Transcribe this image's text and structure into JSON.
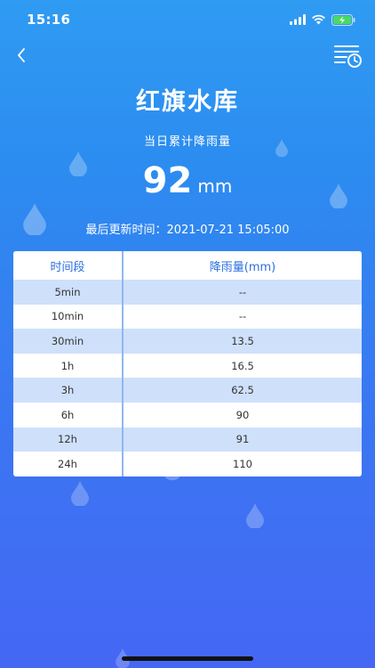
{
  "status": {
    "time": "15:16"
  },
  "page": {
    "title": "红旗水库",
    "subtitle": "当日累计降雨量",
    "value": "92",
    "unit": "mm",
    "update_label": "最后更新时间：",
    "update_time": "2021-07-21 15:05:00"
  },
  "icons": {
    "back": "back-chevron-icon",
    "history": "history-list-clock-icon"
  },
  "table": {
    "headers": [
      "时间段",
      "降雨量(mm)"
    ],
    "rows": [
      {
        "period": "5min",
        "rain": "--"
      },
      {
        "period": "10min",
        "rain": "--"
      },
      {
        "period": "30min",
        "rain": "13.5"
      },
      {
        "period": "1h",
        "rain": "16.5"
      },
      {
        "period": "3h",
        "rain": "62.5"
      },
      {
        "period": "6h",
        "rain": "90"
      },
      {
        "period": "12h",
        "rain": "91"
      },
      {
        "period": "24h",
        "rain": "110"
      }
    ]
  }
}
